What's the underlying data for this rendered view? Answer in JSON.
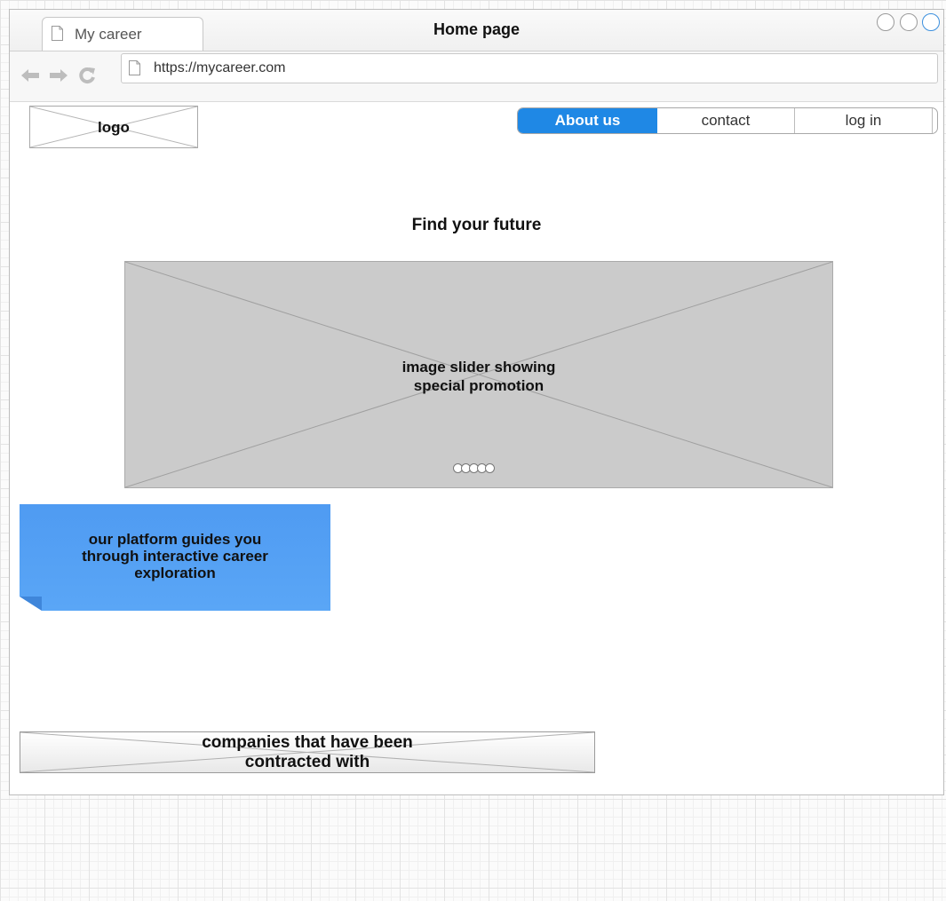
{
  "browser": {
    "tab_label": "My career",
    "window_title": "Home page",
    "url": "https://mycareer.com",
    "icons": [
      "back-arrow-icon",
      "forward-arrow-icon",
      "reload-icon",
      "page-icon"
    ]
  },
  "header": {
    "logo_label": "logo",
    "nav": [
      {
        "label": "About us",
        "active": true
      },
      {
        "label": "contact",
        "active": false
      },
      {
        "label": "log in",
        "active": false
      }
    ]
  },
  "main": {
    "headline": "Find your future",
    "slider": {
      "line1": "image slider showing",
      "line2": "special promotion",
      "dot_count": 5
    },
    "note": {
      "line1": "our platform guides you",
      "line2": "through interactive career",
      "line3": "exploration"
    },
    "companies": {
      "line1": "companies that have been",
      "line2": "contracted with"
    }
  },
  "colors": {
    "accent": "#1f88e5",
    "note_blue": "#4f9bf2",
    "placeholder_gray": "#cbcbcb"
  }
}
